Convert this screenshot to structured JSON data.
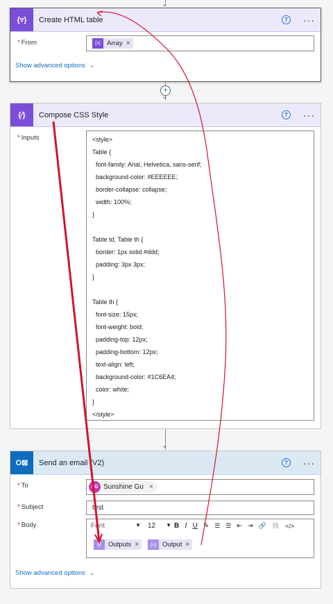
{
  "card1": {
    "title": "Create HTML table",
    "from_label": "From",
    "required": "*",
    "token": "Array",
    "advanced": "Show advanced options"
  },
  "card2": {
    "title": "Compose CSS Style",
    "inputs_label": "Inputs",
    "required": "*",
    "code": [
      "<style>",
      "Table {",
      "  font-family: Arial, Helvetica, sans-serif;",
      "  background-color: #EEEEEE;",
      "  border-collapse: collapse;",
      "  width: 100%;",
      "}",
      "",
      "Table td, Table th {",
      "  border: 1px solid #ddd;",
      "  padding: 3px 3px;",
      "}",
      "",
      "Table th {",
      "  font-size: 15px;",
      "  font-weight: bold;",
      "  padding-top: 12px;",
      "  padding-bottom: 12px;",
      "  text-align: left;",
      "  background-color: #1C6EA4;",
      "  color: white;",
      "}",
      "</style>"
    ]
  },
  "card3": {
    "title": "Send an email (V2)",
    "required": "*",
    "to_label": "To",
    "subject_label": "Subject",
    "body_label": "Body",
    "recipient": "Sunshine Gu",
    "recipient_initials": "SG",
    "subject_value": "test",
    "font_placeholder": "Font",
    "font_size": "12",
    "token1": "Outputs",
    "token2": "Output",
    "advanced": "Show advanced options"
  },
  "icons": {
    "close": "×",
    "more": "···",
    "help": "?",
    "chevron": "⌄",
    "plus": "+",
    "arrow": "↓"
  },
  "colors": {
    "purple_accent": "#7a4ed9",
    "purple_header": "#ece9fb",
    "blue_header": "#dbe9f5",
    "outlook_blue": "#0f6cbd",
    "annotation_red": "#d1132a",
    "link_blue": "#0f6cbd"
  }
}
